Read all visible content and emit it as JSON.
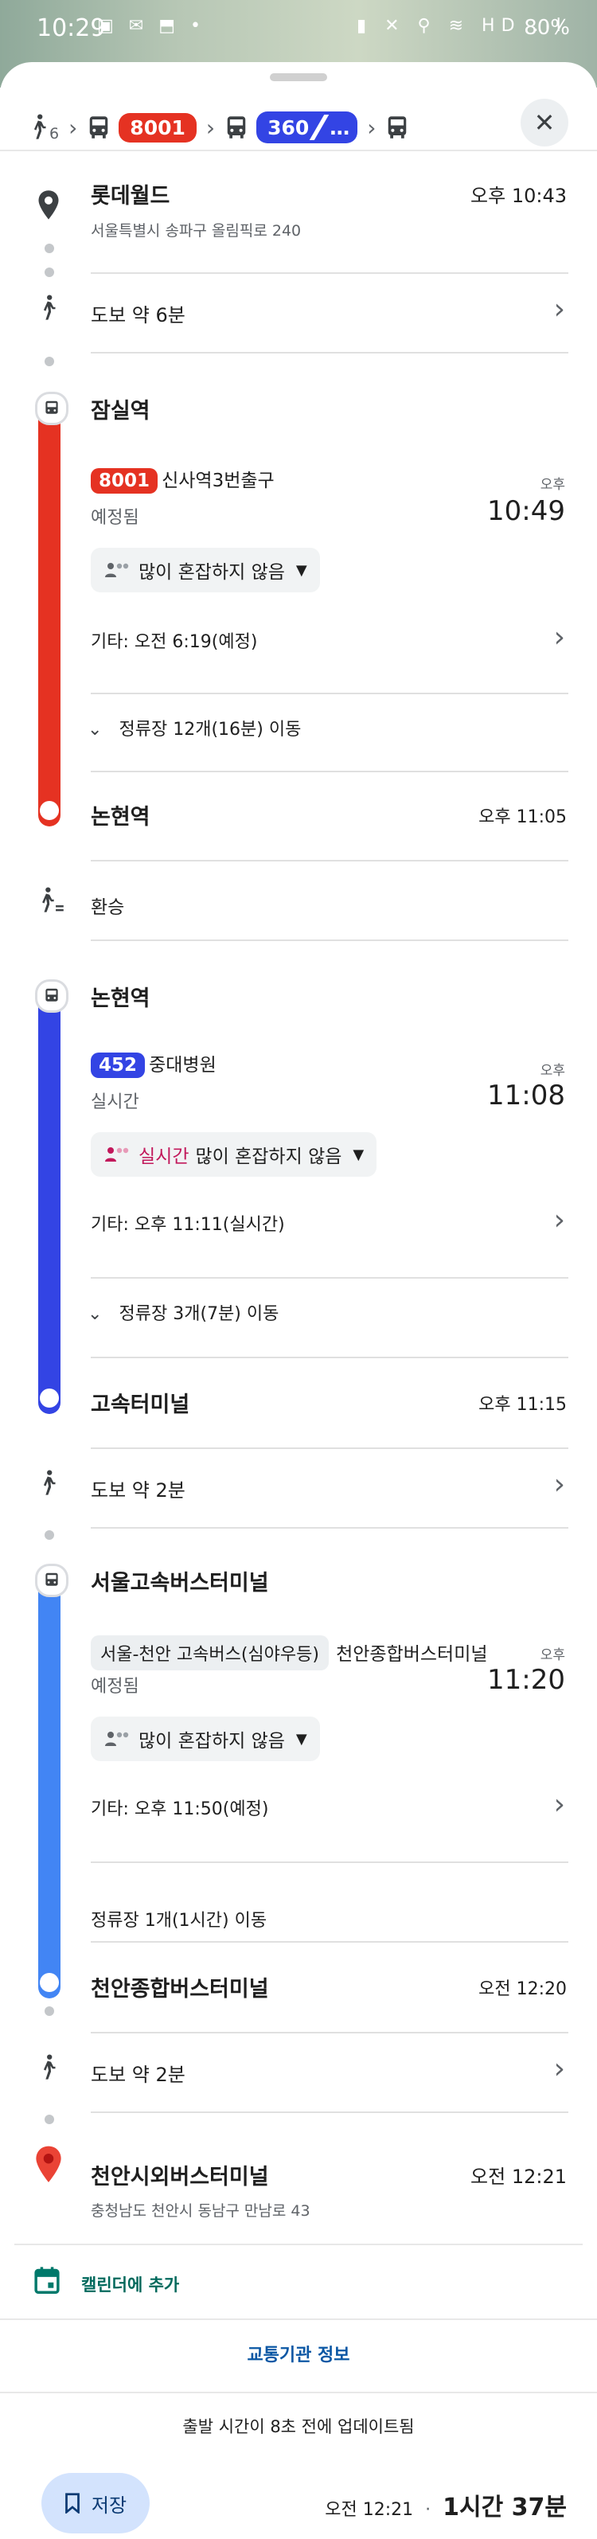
{
  "status_bar": {
    "time": "10:29",
    "left_icons": "▣ ✉ ⬒ •",
    "right_icons": "▮ ✕ ⚲ ≋ HD .ıl",
    "battery": "80%"
  },
  "header": {
    "walk_sub": "6",
    "routes": [
      {
        "label": "8001",
        "color": "#e53222"
      },
      {
        "label": "360",
        "more": "…",
        "color": "#3344e4"
      }
    ]
  },
  "origin": {
    "name": "롯데월드",
    "address": "서울특별시 송파구 올림픽로 240",
    "time": "오후 10:43"
  },
  "walk1": {
    "label": "도보 약 6분"
  },
  "leg1": {
    "stop_from": "잠실역",
    "line": "8001",
    "line_color": "#e53222",
    "destination": "신사역3번출구",
    "status": "예정됨",
    "ampm": "오후",
    "time": "10:49",
    "crowd": "많이 혼잡하지 않음",
    "other": "기타: 오전 6:19(예정)",
    "stops": "정류장 12개(16분) 이동",
    "stop_to": "논현역",
    "arrive": "오후 11:05"
  },
  "transfer": {
    "label": "환승"
  },
  "leg2": {
    "stop_from": "논현역",
    "line": "452",
    "line_color": "#3344e4",
    "destination": "중대병원",
    "status": "실시간",
    "ampm": "오후",
    "time": "11:08",
    "crowd_live": "실시간",
    "crowd": "많이 혼잡하지 않음",
    "other_prefix": "기타: 오후 11:11",
    "other_suffix": "(실시간)",
    "stops": "정류장 3개(7분) 이동",
    "stop_to": "고속터미널",
    "arrive": "오후 11:15"
  },
  "walk2": {
    "label": "도보 약 2분"
  },
  "leg3": {
    "stop_from": "서울고속버스터미널",
    "line": "서울-천안 고속버스(심야우등)",
    "destination": "천안종합버스터미널",
    "status": "예정됨",
    "ampm": "오후",
    "time": "11:20",
    "crowd": "많이 혼잡하지 않음",
    "other": "기타: 오후 11:50(예정)",
    "stops": "정류장 1개(1시간) 이동",
    "stop_to": "천안종합버스터미널",
    "arrive": "오전 12:20"
  },
  "walk3": {
    "label": "도보 약 2분"
  },
  "destination": {
    "name": "천안시외버스터미널",
    "address": "충청남도 천안시 동남구 만남로 43",
    "time": "오전 12:21"
  },
  "actions": {
    "calendar": "캘린더에 추가",
    "transit_info": "교통기관 정보",
    "updated": "출발 시간이 8초 전에 업데이트됨",
    "save": "저장",
    "arrive_time": "오전 12:21",
    "separator": "·",
    "duration": "1시간 37분"
  },
  "colors": {
    "red": "#e53222",
    "blue1": "#3344e4",
    "blue2": "#4285f4",
    "pin": "#ea4335"
  }
}
